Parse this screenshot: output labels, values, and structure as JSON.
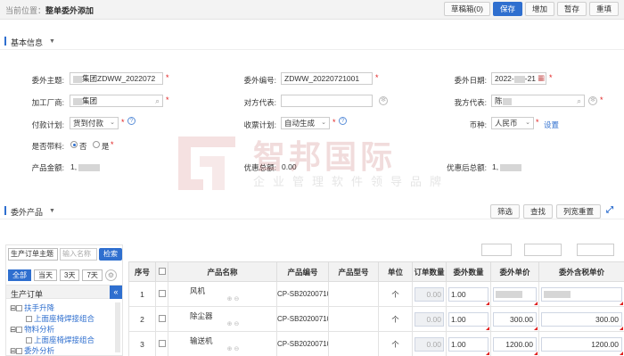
{
  "breadcrumb": {
    "prefix": "当前位置：",
    "current": "整单委外添加"
  },
  "toolbar": {
    "draft": "草稿箱(0)",
    "save": "保存",
    "add": "增加",
    "hold": "暂存",
    "refill": "重填"
  },
  "basic": {
    "section_title": "基本信息",
    "theme_label": "委外主题:",
    "theme_value": "集团ZDWW_2022072",
    "code_label": "委外编号:",
    "code_value": "ZDWW_20220721001",
    "date_label": "委外日期:",
    "date_value_a": "2022-",
    "date_value_b": "-21",
    "factory_label": "加工厂商:",
    "factory_value": "集团",
    "counterpart_label": "对方代表:",
    "counterpart_value": "",
    "our_rep_label": "我方代表:",
    "our_rep_value": "陈",
    "pay_label": "付款计划:",
    "pay_value": "货到付款",
    "receipt_label": "收票计划:",
    "receipt_value": "自动生成",
    "currency_label": "币种:",
    "currency_value": "人民币",
    "currency_setting": "设置",
    "material_label": "是否带料:",
    "material_no": "否",
    "material_yes": "是",
    "amount_label": "产品金额:",
    "amount_value": "1,",
    "discount_label": "优惠总额:",
    "discount_value": "0.00",
    "after_label": "优惠后总额:",
    "after_value": "1,"
  },
  "watermark": {
    "title": "智邦国际",
    "subtitle": "企业管理软件领导品牌"
  },
  "products": {
    "section_title": "委外产品",
    "filter_btn": "筛选",
    "find_btn": "查找",
    "reset_btn": "列宽重置"
  },
  "left_panel": {
    "select_value": "生产订单主题",
    "input_placeholder": "输入名称",
    "search_btn": "检索",
    "tabs": [
      "全部",
      "当天",
      "3天",
      "7天"
    ],
    "header": "生产订单",
    "tree": [
      {
        "label": "扶手升降",
        "level": 1
      },
      {
        "label": "上面座椅焊接组合",
        "level": 2
      },
      {
        "label": "物料分析",
        "level": 1
      },
      {
        "label": "上面座椅焊接组合",
        "level": 2
      },
      {
        "label": "委外分析",
        "level": 1
      }
    ]
  },
  "grid": {
    "headers": [
      "序号",
      "",
      "产品名称",
      "产品编号",
      "产品型号",
      "单位",
      "订单数量",
      "委外数量",
      "委外单价",
      "委外含税单价"
    ],
    "rows": [
      {
        "no": "1",
        "name": "风机",
        "code": "CP-SB2020071000",
        "model": "",
        "unit": "个",
        "order_qty": "0.00",
        "qty": "1.00",
        "price": "",
        "tax_price": ""
      },
      {
        "no": "2",
        "name": "除尘器",
        "code": "CP-SB2020071000",
        "model": "",
        "unit": "个",
        "order_qty": "0.00",
        "qty": "1.00",
        "price": "300.00",
        "tax_price": "300.00"
      },
      {
        "no": "3",
        "name": "输送机",
        "code": "CP-SB2020071000",
        "model": "",
        "unit": "个",
        "order_qty": "0.00",
        "qty": "1.00",
        "price": "1200.00",
        "tax_price": "1200.00"
      }
    ]
  }
}
